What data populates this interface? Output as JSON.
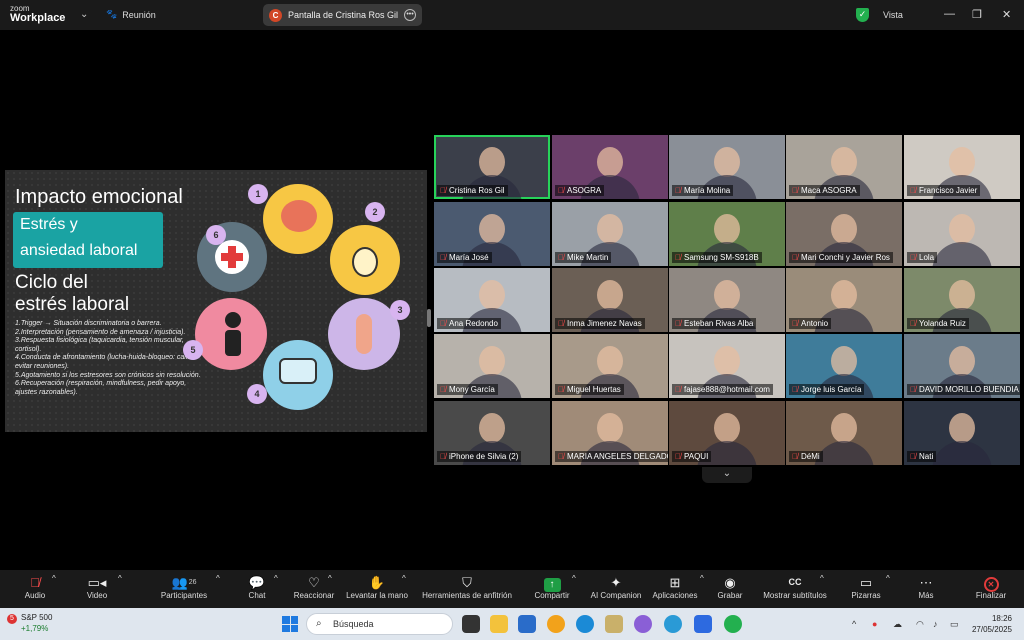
{
  "titlebar": {
    "logo_top": "zoom",
    "logo_bottom": "Workplace",
    "meeting": "Reunión",
    "share_badge": "C",
    "share_label": "Pantalla de Cristina Ros Gil",
    "view": "Vista"
  },
  "slide": {
    "title": "Impacto emocional",
    "box_line1": "Estrés y",
    "box_line2": "ansiedad laboral",
    "heading_line1": "Ciclo del",
    "heading_line2": "estrés laboral",
    "list": [
      "1.Trigger → Situación discriminatoria o barrera.",
      "2.Interpretación (pensamiento de amenaza / injusticia).",
      "3.Respuesta fisiológica (taquicardia, tensión muscular, cortisol).",
      "4.Conducta de afrontamiento (lucha-huida-bloqueo: callar, evitar reuniones).",
      "5.Agotamiento si los estresores son crónicos sin resolución.",
      "6.Recuperación (respiración, mindfulness, pedir apoyo, ajustes razonables)."
    ],
    "numbers": [
      "1",
      "2",
      "3",
      "4",
      "5",
      "6"
    ]
  },
  "participants": [
    {
      "name": "Cristina Ros Gil",
      "bg": "#3b3f4a"
    },
    {
      "name": "ASOGRA",
      "bg": "#6b3f6a"
    },
    {
      "name": "María Molina",
      "bg": "#8a8f97"
    },
    {
      "name": "Maca ASOGRA",
      "bg": "#a9a39a"
    },
    {
      "name": "Francisco Javier",
      "bg": "#cfcac3"
    },
    {
      "name": "María José",
      "bg": "#4b5a70"
    },
    {
      "name": "Mike Martin",
      "bg": "#9aa0a7"
    },
    {
      "name": "Samsung SM-S918B",
      "bg": "#5f7f4a"
    },
    {
      "name": "Mari Conchi y Javier Ros",
      "bg": "#7a6e66"
    },
    {
      "name": "Lola",
      "bg": "#bdb8b3"
    },
    {
      "name": "Ana Redondo",
      "bg": "#b7bcc2"
    },
    {
      "name": "Inma Jimenez Navas",
      "bg": "#6b5f55"
    },
    {
      "name": "Esteban Rivas Alba",
      "bg": "#8f8882"
    },
    {
      "name": "Antonio",
      "bg": "#9a8c7a"
    },
    {
      "name": "Yolanda Ruiz",
      "bg": "#7d8a6a"
    },
    {
      "name": "Mony García",
      "bg": "#b7b2ab"
    },
    {
      "name": "Miguel Huertas",
      "bg": "#a89a8a"
    },
    {
      "name": "fajase888@hotmail.com",
      "bg": "#c7c3be"
    },
    {
      "name": "Jorge luis García",
      "bg": "#3f7c9a"
    },
    {
      "name": "DAVID MORILLO BUENDIA",
      "bg": "#6b7c8a"
    },
    {
      "name": "iPhone de Silvia (2)",
      "bg": "#4a4a4a"
    },
    {
      "name": "MARIA ANGELES DELGADO",
      "bg": "#a08b78"
    },
    {
      "name": "PAQUI",
      "bg": "#5e4a3e"
    },
    {
      "name": "DéMi",
      "bg": "#6e5a4a"
    },
    {
      "name": "Nati",
      "bg": "#2d3442"
    }
  ],
  "toolbar": {
    "audio": "Audio",
    "video": "Video",
    "participants": "Participantes",
    "participants_count": "26",
    "chat": "Chat",
    "react": "Reaccionar",
    "raise_hand": "Levantar la mano",
    "host_tools": "Herramientas de anfitrión",
    "share": "Compartir",
    "ai": "AI Companion",
    "apps": "Aplicaciones",
    "record": "Grabar",
    "captions": "Mostrar subtítulos",
    "whiteboards": "Pizarras",
    "more": "Más",
    "end": "Finalizar",
    "cc": "CC"
  },
  "taskbar": {
    "stock_name": "S&P 500",
    "stock_change": "+1,79%",
    "stock_badge": "5",
    "search": "Búsqueda",
    "time": "18:26",
    "date": "27/05/2025"
  },
  "colors": {
    "accent_green": "#27d35a",
    "teal_box": "#1aa3a3",
    "mute_red": "#ff4d4d",
    "end_red": "#e23b3b"
  }
}
